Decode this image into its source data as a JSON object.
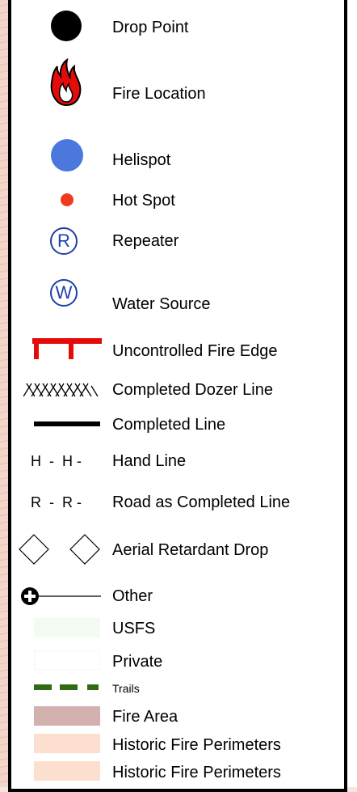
{
  "legend": {
    "items": [
      {
        "label": "Drop Point",
        "icon": "drop-point-icon"
      },
      {
        "label": "Fire Location",
        "icon": "fire-location-icon"
      },
      {
        "label": "Helispot",
        "icon": "helispot-icon"
      },
      {
        "label": "Hot Spot",
        "icon": "hot-spot-icon"
      },
      {
        "label": "Repeater",
        "icon": "repeater-icon",
        "symbol_text": "R"
      },
      {
        "label": "Water Source",
        "icon": "water-source-icon",
        "symbol_text": "W"
      },
      {
        "label": "Uncontrolled Fire Edge",
        "icon": "uncontrolled-fire-edge-icon"
      },
      {
        "label": "Completed Dozer Line",
        "icon": "dozer-line-icon"
      },
      {
        "label": "Completed Line",
        "icon": "completed-line-icon"
      },
      {
        "label": "Hand Line",
        "icon": "hand-line-icon",
        "symbol_text": "H  -  H -"
      },
      {
        "label": "Road as Completed Line",
        "icon": "road-line-icon",
        "symbol_text": "R  -  R -"
      },
      {
        "label": "Aerial Retardant Drop",
        "icon": "retardant-drop-icon"
      },
      {
        "label": "Other",
        "icon": "other-icon"
      },
      {
        "label": "USFS",
        "icon": "usfs-swatch",
        "color": "#f3fbf2"
      },
      {
        "label": "Private",
        "icon": "private-swatch",
        "color": "#ffffff"
      },
      {
        "label": "Trails",
        "icon": "trails-icon",
        "color": "#2e6b12"
      },
      {
        "label": "Fire Area",
        "icon": "fire-area-swatch",
        "color": "#d3b1af"
      },
      {
        "label": "Historic Fire Perimeters",
        "icon": "historic-perimeter-swatch",
        "color": "#fddfd0"
      },
      {
        "label": "Historic Fire Perimeters",
        "icon": "historic-perimeter-swatch-2",
        "color": "#fddfd0"
      }
    ]
  }
}
